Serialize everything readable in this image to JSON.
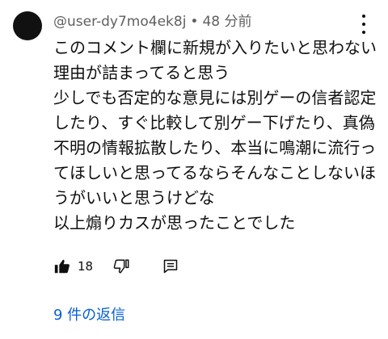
{
  "comment": {
    "author": "@user-dy7mo4ek8j",
    "separator": "•",
    "time": "48 分前",
    "lines": [
      "このコメント欄に新規が入りたいと思わない",
      "理由が詰まってると思う",
      "少しでも否定的な意見には別ゲーの信者認定",
      "したり、すぐ比較して別ゲー下げたり、真偽",
      "不明の情報拡散したり、本当に鳴潮に流行っ",
      "てほしいと思ってるならそんなことしないほ",
      "うがいいと思うけどな",
      "以上煽りカスが思ったことでした"
    ],
    "like_count": "18",
    "replies_label": "9 件の返信"
  },
  "icons": {
    "like": "thumbs-up-icon",
    "dislike": "thumbs-down-icon",
    "reply": "reply-comment-icon",
    "more": "more-vertical-icon"
  },
  "colors": {
    "link": "#065fd4",
    "meta": "#606060",
    "text": "#0f0f0f",
    "avatar": "#111111"
  }
}
